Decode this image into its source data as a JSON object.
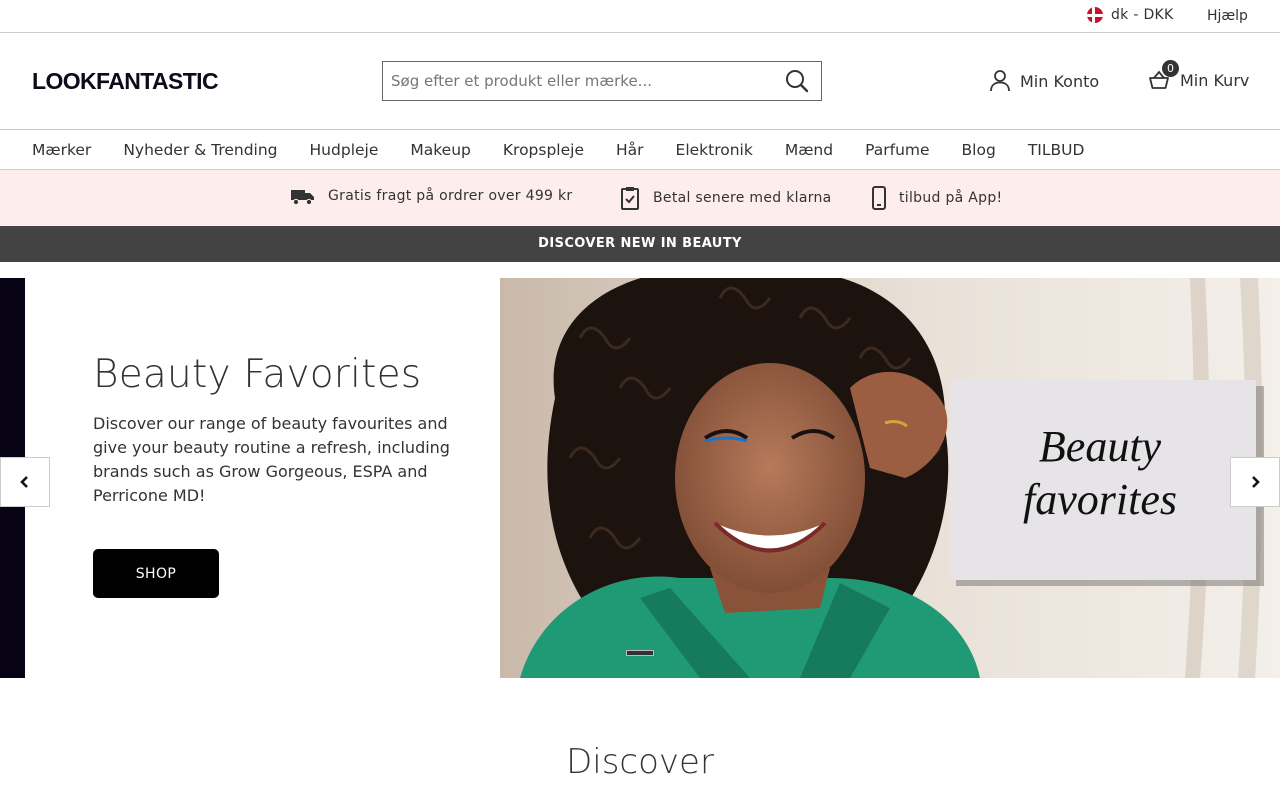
{
  "utility": {
    "locale_label": "dk - DKK",
    "help_label": "Hjælp"
  },
  "header": {
    "logo_text": "LOOKFANTASTIC",
    "search_placeholder": "Søg efter et produkt eller mærke...",
    "account_label": "Min Konto",
    "basket_label": "Min Kurv",
    "basket_count": "0"
  },
  "nav": {
    "items": [
      "Mærker",
      "Nyheder & Trending",
      "Hudpleje",
      "Makeup",
      "Kropspleje",
      "Hår",
      "Elektronik",
      "Mænd",
      "Parfume",
      "Blog",
      "TILBUD"
    ]
  },
  "promos": [
    {
      "icon": "delivery-truck-icon",
      "text": "Gratis fragt på ordrer over 499 kr"
    },
    {
      "icon": "clipboard-check-icon",
      "text": "Betal senere med klarna"
    },
    {
      "icon": "mobile-phone-icon",
      "text": "tilbud på App!"
    }
  ],
  "announcement": "DISCOVER NEW IN BEAUTY",
  "hero": {
    "title": "Beauty Favorites",
    "text": "Discover our range of beauty favourites and give your beauty routine a refresh, including brands such as Grow Gorgeous, ESPA and Perricone MD!",
    "button_label": "SHOP",
    "image_card_line1": "Beauty",
    "image_card_line2": "favorites"
  },
  "discover_title": "Discover",
  "colors": {
    "promo_bg": "#fdeeed",
    "announce_bg": "#434343",
    "button_bg": "#000000",
    "jacket": "#1f9a74"
  }
}
